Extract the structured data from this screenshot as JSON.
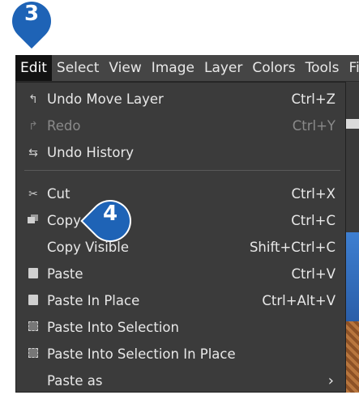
{
  "badges": {
    "step3": "3",
    "step4": "4"
  },
  "colors": {
    "badge": "#1e63b6",
    "menu_bg": "#3b3b3b",
    "menubar_bg": "#454545"
  },
  "menubar": {
    "items": [
      "Edit",
      "Select",
      "View",
      "Image",
      "Layer",
      "Colors",
      "Tools",
      "Filt"
    ],
    "active": "Edit"
  },
  "edit_menu": {
    "items": [
      {
        "icon": "undo-icon",
        "label": "Undo Move Layer",
        "shortcut": "Ctrl+Z"
      },
      {
        "icon": "redo-icon",
        "label": "Redo",
        "shortcut": "Ctrl+Y",
        "disabled": true
      },
      {
        "icon": "undo-history-icon",
        "label": "Undo History",
        "shortcut": ""
      },
      {
        "icon": "scissors-icon",
        "label": "Cut",
        "shortcut": "Ctrl+X"
      },
      {
        "icon": "copy-icon",
        "label": "Copy",
        "shortcut": "Ctrl+C"
      },
      {
        "icon": "",
        "label": "Copy Visible",
        "shortcut": "Shift+Ctrl+C"
      },
      {
        "icon": "paste-icon",
        "label": "Paste",
        "shortcut": "Ctrl+V"
      },
      {
        "icon": "paste-in-place-icon",
        "label": "Paste In Place",
        "shortcut": "Ctrl+Alt+V"
      },
      {
        "icon": "paste-into-selection-icon",
        "label": "Paste Into Selection",
        "shortcut": ""
      },
      {
        "icon": "paste-into-selection-in-place-icon",
        "label": "Paste Into Selection In Place",
        "shortcut": ""
      },
      {
        "icon": "",
        "label": "Paste as",
        "shortcut": ""
      }
    ]
  }
}
